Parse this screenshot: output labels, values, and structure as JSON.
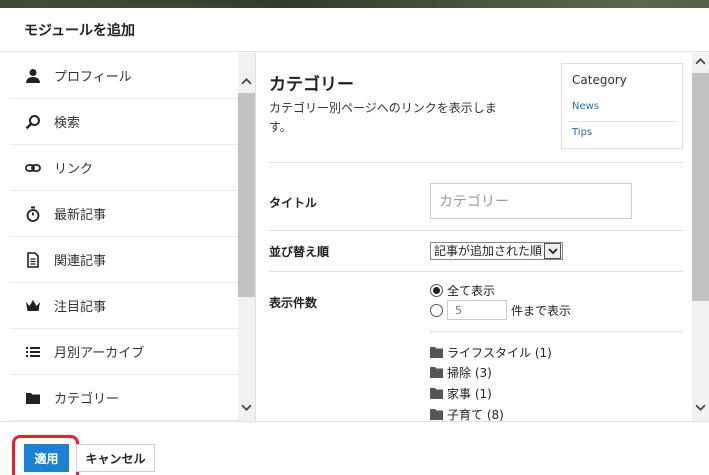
{
  "modal": {
    "title": "モジュールを追加"
  },
  "sidebar": {
    "items": [
      {
        "label": "プロフィール",
        "icon": "person-icon"
      },
      {
        "label": "検索",
        "icon": "search-icon"
      },
      {
        "label": "リンク",
        "icon": "link-icon"
      },
      {
        "label": "最新記事",
        "icon": "stopwatch-icon"
      },
      {
        "label": "関連記事",
        "icon": "document-icon"
      },
      {
        "label": "注目記事",
        "icon": "crown-icon"
      },
      {
        "label": "月別アーカイブ",
        "icon": "list-icon"
      },
      {
        "label": "カテゴリー",
        "icon": "folder-icon"
      }
    ]
  },
  "content": {
    "title": "カテゴリー",
    "description": "カテゴリー別ページへのリンクを表示します。",
    "preview": {
      "title": "Category",
      "items": [
        "News",
        "Tips"
      ]
    },
    "fields": {
      "title_label": "タイトル",
      "title_placeholder": "カテゴリー",
      "sort_label": "並び替え順",
      "sort_value": "記事が追加された順",
      "count_label": "表示件数",
      "count_all": "全て表示",
      "count_number": "5",
      "count_suffix": "件まで表示"
    },
    "categories": [
      "ライフスタイル (1)",
      "掃除 (3)",
      "家事 (1)",
      "子育て (8)"
    ]
  },
  "footer": {
    "apply_label": "適用",
    "cancel_label": "キャンセル"
  },
  "colors": {
    "accent": "#1a82d4",
    "highlight": "#e3232d"
  }
}
